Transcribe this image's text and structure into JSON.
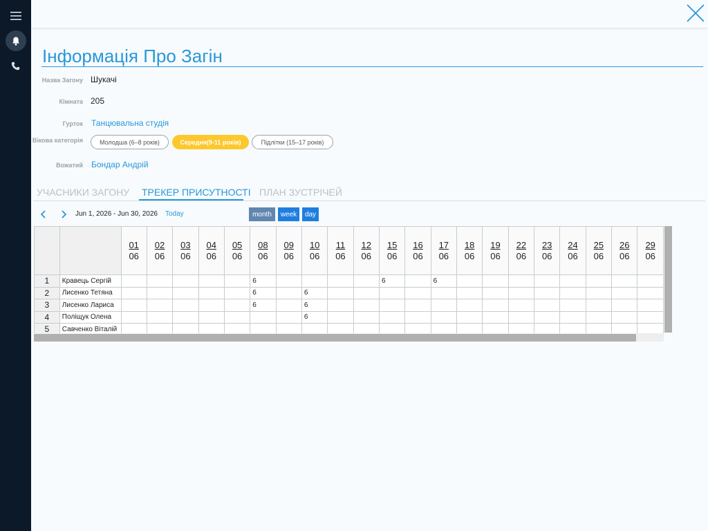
{
  "header": {
    "title": "Інформація Про Загін"
  },
  "fields": {
    "name_label": "Назва Загону",
    "name_value": "Шукачі",
    "room_label": "Кімната",
    "room_value": "205",
    "club_label": "Гурток",
    "club_value": "Танцювальна студія",
    "age_label": "Вікова категорія",
    "age_chips": [
      "Молодша (6–8 років)",
      "Середня(9-11 років)",
      "Підлітки (15–17 років)"
    ],
    "leader_label": "Вожатий",
    "leader_value": "Бондар Андрій"
  },
  "tabs": [
    "УЧАСНИКИ ЗАГОНУ",
    "ТРЕКЕР ПРИСУТНОСТІ",
    "ПЛАН ЗУСТРІЧЕЙ"
  ],
  "calendar": {
    "date_range": "Jun 1, 2026 - Jun 30, 2026",
    "today_label": "Today",
    "view_month": "month",
    "view_week": "week",
    "view_day": "day"
  },
  "grid": {
    "columns": [
      "01",
      "02",
      "03",
      "04",
      "05",
      "08",
      "09",
      "10",
      "11",
      "12",
      "15",
      "16",
      "17",
      "18",
      "19",
      "22",
      "23",
      "24",
      "25",
      "26",
      "29"
    ],
    "month": "06",
    "rows": [
      {
        "num": "1",
        "name": "Кравець Сергій",
        "marks": {
          "08": "6",
          "15": "6",
          "17": "6"
        }
      },
      {
        "num": "2",
        "name": "Лисенко  Тетяна",
        "marks": {
          "08": "6",
          "10": "6"
        }
      },
      {
        "num": "3",
        "name": "Лисенко Лариса",
        "marks": {
          "08": "6",
          "10": "6"
        }
      },
      {
        "num": "4",
        "name": "Поліщук Олена",
        "marks": {
          "10": "6"
        }
      },
      {
        "num": "5",
        "name": "Савченко Віталій",
        "marks": {}
      }
    ]
  },
  "colors": {
    "accent": "#2a97d9",
    "sidebar": "#0b1929",
    "active_chip": "#fdc82d",
    "btn_month": "#6087b0",
    "btn_week": "#1e7ee0",
    "btn_day": "#1e7ee0"
  },
  "icons": [
    "menu-icon",
    "bell-icon",
    "phone-icon",
    "close-icon",
    "chevron-left-icon",
    "chevron-right-icon"
  ]
}
